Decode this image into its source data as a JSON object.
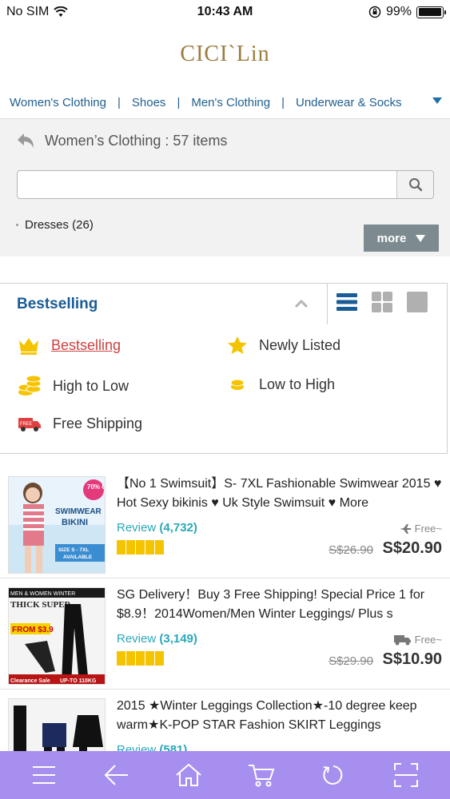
{
  "status_bar": {
    "carrier": "No SIM",
    "time": "10:43 AM",
    "battery": "99%",
    "battery_level": 0.99
  },
  "logo": "CICI`Lin",
  "category_nav": [
    "Women's Clothing",
    "Shoes",
    "Men's Clothing",
    "Underwear & Socks"
  ],
  "breadcrumb": "Women’s Clothing : 57 items",
  "search": {
    "value": "",
    "placeholder": ""
  },
  "subcategory": "Dresses (26)",
  "more_label": "more",
  "sort": {
    "current": "Bestselling",
    "options": [
      {
        "label": "Bestselling",
        "icon": "crown-icon"
      },
      {
        "label": "Newly Listed",
        "icon": "star-icon"
      },
      {
        "label": "High to Low",
        "icon": "coins-stack-icon"
      },
      {
        "label": "Low to High",
        "icon": "coin-icon"
      },
      {
        "label": "Free Shipping",
        "icon": "free-delivery-truck-icon"
      }
    ]
  },
  "products": [
    {
      "title": "【No 1 Swimsuit】S- 7XL Fashionable Swimwear 2015 ♥ Hot Sexy bikinis ♥ Uk Style Swimsuit ♥ More",
      "review_label": "Review",
      "review_count": "(4,732)",
      "shipping": "Free~",
      "ship_icon": "plane-icon",
      "original_price": "S$26.90",
      "price": "S$20.90",
      "thumb_text": [
        "70% OFF",
        "SWIMWEAR",
        "BIKINI",
        "SIZE S - 7XL",
        "AVAILABLE"
      ]
    },
    {
      "title": "SG Delivery！Buy 3 Free Shipping! Special Price 1 for $8.9！2014Women/Men Winter Leggings/ Plus s",
      "review_label": "Review",
      "review_count": "(3,149)",
      "shipping": "Free~",
      "ship_icon": "truck-icon",
      "original_price": "S$29.90",
      "price": "S$10.90",
      "thumb_text": [
        "MEN & WOMEN WINTER",
        "THICK SUPER",
        "FROM $3.9",
        "Clearance Sale",
        "UP-TO 110KG"
      ]
    },
    {
      "title": "2015 ★Winter Leggings Collection★-10 degree keep warm★K-POP STAR Fashion SKIRT Leggings",
      "review_label": "Review",
      "review_count": "(581)",
      "shipping": "",
      "ship_icon": "",
      "original_price": "",
      "price": "",
      "thumb_text": []
    }
  ],
  "toolbar": [
    "menu-icon",
    "back-arrow-icon",
    "home-icon",
    "cart-icon",
    "refresh-icon",
    "scan-icon"
  ],
  "colors": {
    "nav_blue": "#1f5f8f",
    "toolbar": "#a78ff0",
    "review": "#2aa7b8",
    "star": "#f5c400",
    "logo": "#9c7b3e"
  }
}
